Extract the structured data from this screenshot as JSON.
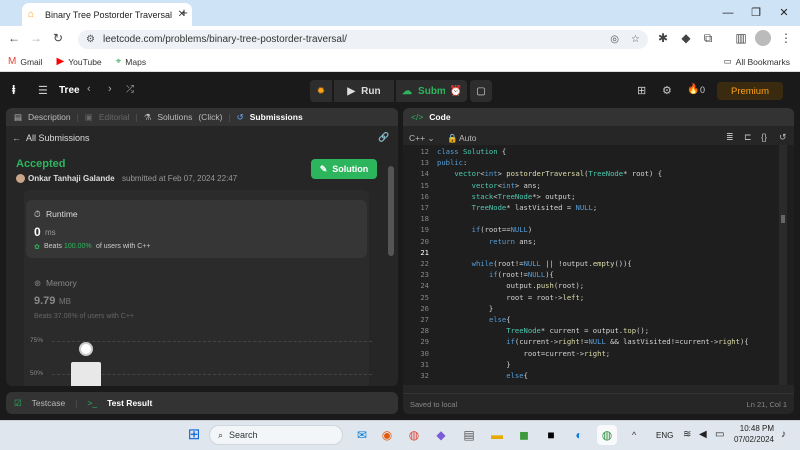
{
  "browser": {
    "tab_title": "Binary Tree Postorder Traversal",
    "url": "leetcode.com/problems/binary-tree-postorder-traversal/",
    "bookmarks": [
      "Gmail",
      "YouTube",
      "Maps"
    ],
    "all_bookmarks": "All Bookmarks"
  },
  "lc": {
    "problem_list": "Tree",
    "run": "Run",
    "submit": "Submit",
    "streak": "0",
    "premium": "Premium"
  },
  "left": {
    "tabs": [
      "Description",
      "Editorial",
      "Solutions",
      "(Click)",
      "Submissions"
    ],
    "all_submissions": "All Submissions",
    "status": "Accepted",
    "user": "Onkar Tanhaji Galande",
    "submitted_at": "submitted at Feb 07, 2024 22:47",
    "solution_btn": "Solution",
    "runtime_label": "Runtime",
    "runtime_value": "0",
    "runtime_unit": "ms",
    "runtime_beats_pre": "Beats",
    "runtime_beats_pct": "100.00%",
    "runtime_beats_post": "of users with C++",
    "memory_label": "Memory",
    "memory_value": "9.79",
    "memory_unit": "MB",
    "memory_beats": "Beats 37.06% of users with C++",
    "y75": "75%",
    "y50": "50%"
  },
  "test": {
    "testcase": "Testcase",
    "result": "Test Result"
  },
  "right": {
    "header": "Code",
    "language": "C++",
    "mode": "Auto",
    "saved": "Saved to local",
    "position": "Ln 21, Col 1"
  },
  "code_lines": [
    {
      "n": "12",
      "t": "class Solution {"
    },
    {
      "n": "13",
      "t": "public:"
    },
    {
      "n": "14",
      "t": "    vector<int> postorderTraversal(TreeNode* root) {"
    },
    {
      "n": "15",
      "t": "        vector<int> ans;"
    },
    {
      "n": "16",
      "t": "        stack<TreeNode*> output;"
    },
    {
      "n": "17",
      "t": "        TreeNode* lastVisited = NULL;"
    },
    {
      "n": "18",
      "t": ""
    },
    {
      "n": "19",
      "t": "        if(root==NULL)"
    },
    {
      "n": "20",
      "t": "            return ans;"
    },
    {
      "n": "21",
      "t": ""
    },
    {
      "n": "22",
      "t": "        while(root!=NULL || !output.empty()){"
    },
    {
      "n": "23",
      "t": "            if(root!=NULL){"
    },
    {
      "n": "24",
      "t": "                output.push(root);"
    },
    {
      "n": "25",
      "t": "                root = root->left;"
    },
    {
      "n": "26",
      "t": "            }"
    },
    {
      "n": "27",
      "t": "            else{"
    },
    {
      "n": "28",
      "t": "                TreeNode* current = output.top();"
    },
    {
      "n": "29",
      "t": "                if(current->right!=NULL && lastVisited!=current->right){"
    },
    {
      "n": "30",
      "t": "                    root=current->right;"
    },
    {
      "n": "31",
      "t": "                }"
    },
    {
      "n": "32",
      "t": "                else{"
    }
  ],
  "taskbar": {
    "search": "Search",
    "lang": "ENG",
    "time": "10:48 PM",
    "date": "07/02/2024"
  }
}
